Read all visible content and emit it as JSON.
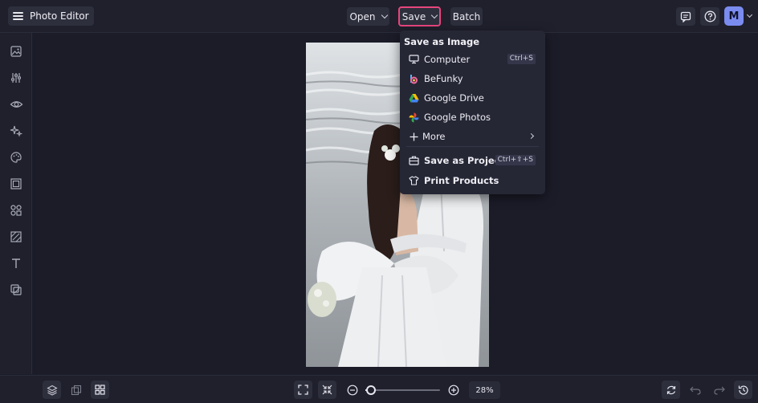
{
  "app": {
    "title": "Photo Editor"
  },
  "toolbar": {
    "open_label": "Open",
    "save_label": "Save",
    "batch_label": "Batch",
    "avatar_initial": "M"
  },
  "sidebar": {
    "items": [
      {
        "name": "image-icon"
      },
      {
        "name": "adjust-sliders-icon"
      },
      {
        "name": "eye-icon"
      },
      {
        "name": "effects-sparkle-icon"
      },
      {
        "name": "artsy-palette-icon"
      },
      {
        "name": "frames-icon"
      },
      {
        "name": "graphics-shapes-icon"
      },
      {
        "name": "overlays-icon"
      },
      {
        "name": "text-icon"
      },
      {
        "name": "textures-icon"
      }
    ]
  },
  "save_menu": {
    "heading": "Save as Image",
    "items": [
      {
        "label": "Computer",
        "icon": "monitor-icon",
        "shortcut": "Ctrl+S"
      },
      {
        "label": "BeFunky",
        "icon": "befunky-logo-icon"
      },
      {
        "label": "Google Drive",
        "icon": "google-drive-icon"
      },
      {
        "label": "Google Photos",
        "icon": "google-photos-icon"
      },
      {
        "label": "More",
        "icon": "plus-icon"
      },
      {
        "label": "Save as Project",
        "icon": "project-briefcase-icon",
        "shortcut": "Ctrl+⇧+S"
      },
      {
        "label": "Print Products",
        "icon": "tshirt-icon"
      }
    ]
  },
  "bottom": {
    "zoom_label": "28%",
    "zoom_level": 0.08
  },
  "colors": {
    "save_highlight": "#e8457e",
    "avatar": "#7b8cf0",
    "background": "#1c1d2a"
  }
}
